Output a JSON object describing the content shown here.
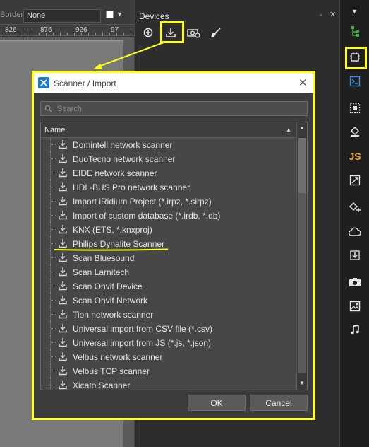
{
  "toolbar": {
    "border_label": "Border",
    "border_value": "None"
  },
  "ruler": {
    "labels": [
      "826",
      "876",
      "926",
      "97"
    ]
  },
  "devices": {
    "title": "Devices",
    "tools": [
      "add-icon",
      "import-icon",
      "scanner-device-icon",
      "clear-icon"
    ]
  },
  "dialog": {
    "title": "Scanner / Import",
    "search_placeholder": "Search",
    "column_header": "Name",
    "items": [
      "Domintell network scanner",
      "DuoTecno network scanner",
      "EIDE network scanner",
      "HDL-BUS Pro network scanner",
      "Import iRidium Project (*.irpz, *.sirpz)",
      "Import of custom database (*.irdb, *.db)",
      "KNX (ETS, *.knxproj)",
      "Philips Dynalite Scanner",
      "Scan Bluesound",
      "Scan Larnitech",
      "Scan Onvif Device",
      "Scan Onvif Network",
      "Tion network scanner",
      "Universal import from CSV file (*.csv)",
      "Universal import from JS (*.js, *.json)",
      "Velbus network scanner",
      "Velbus TCP scanner",
      "Xicato Scanner"
    ],
    "ok_label": "OK",
    "cancel_label": "Cancel"
  },
  "colors": {
    "highlight": "#ffff19",
    "accent_green": "#3fb53f",
    "js_orange": "#f0a030"
  },
  "strip_icons": [
    "tree-icon",
    "device-chip-icon",
    "script-icon",
    "image-tools-icon",
    "paint-bucket-icon",
    "js-icon",
    "resize-icon",
    "paint-bucket-plus-icon",
    "cloud-icon",
    "import-icon",
    "camera-icon",
    "picture-icon",
    "music-icon"
  ]
}
